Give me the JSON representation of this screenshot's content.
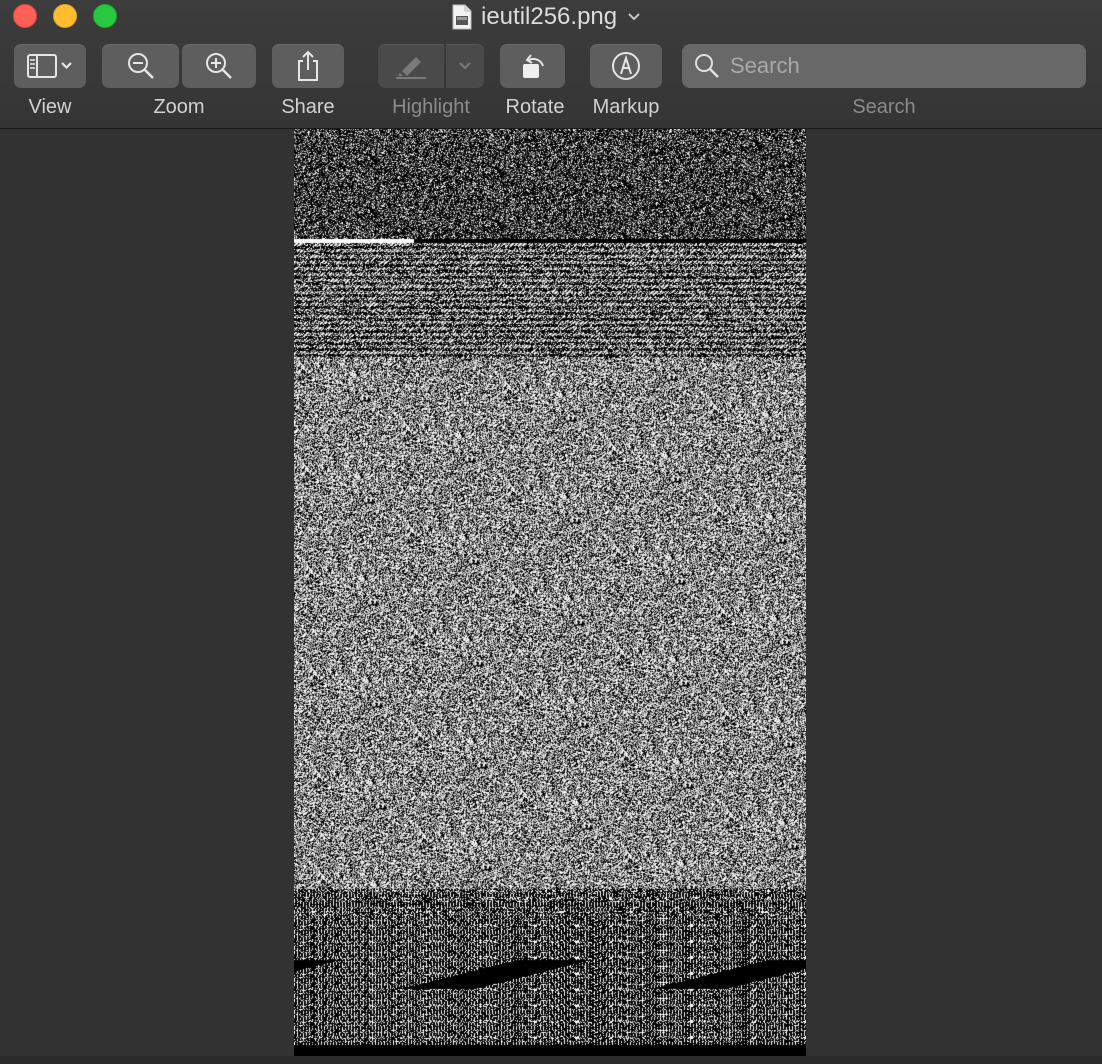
{
  "window": {
    "title": "ieutil256.png",
    "file_icon": "document-icon",
    "title_menu_icon": "chevron-down-icon"
  },
  "toolbar": {
    "view_label": "View",
    "zoom_label": "Zoom",
    "share_label": "Share",
    "highlight_label": "Highlight",
    "rotate_label": "Rotate",
    "markup_label": "Markup",
    "search_label": "Search",
    "search_placeholder": "Search"
  },
  "colors": {
    "close": "#fe5f57",
    "minimize": "#febc2e",
    "maximize": "#28c840",
    "toolbar_button": "#5e5e5e",
    "viewer_background": "#323232"
  }
}
